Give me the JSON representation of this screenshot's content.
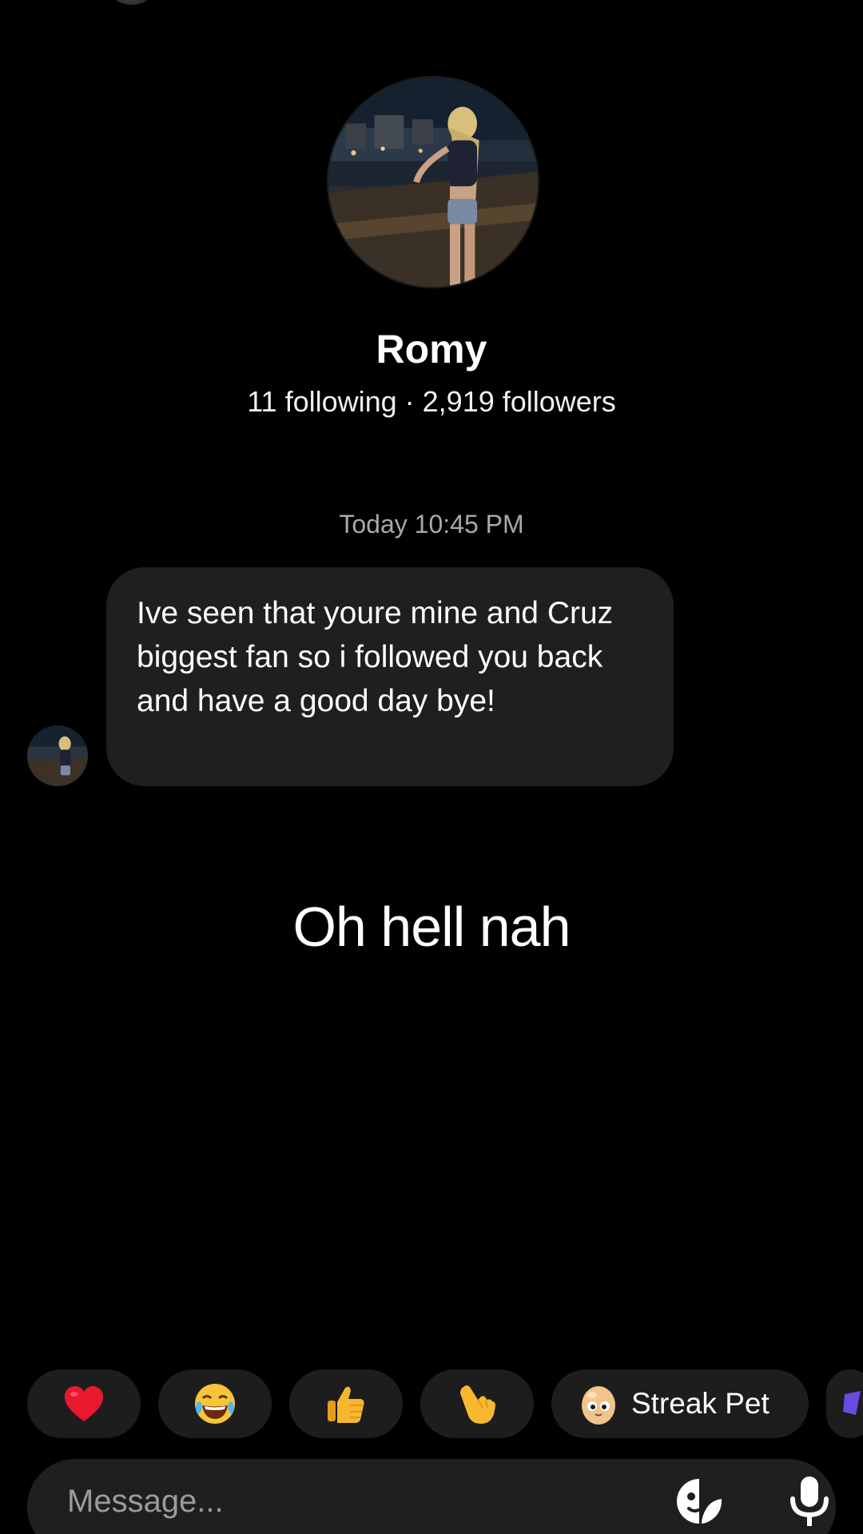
{
  "profile": {
    "name": "Romy",
    "stats": "11 following · 2,919 followers"
  },
  "thread": {
    "timestamp": "Today 10:45 PM",
    "messages": [
      {
        "text": "Ive seen that youre mine and Cruz biggest fan so i followed you back and have a good day bye!"
      }
    ]
  },
  "overlay": {
    "caption": "Oh hell nah"
  },
  "quick_replies": [
    {
      "icon": "red-heart-icon"
    },
    {
      "icon": "tears-of-joy-icon"
    },
    {
      "icon": "thumbs-up-icon"
    },
    {
      "icon": "pointing-hand-icon"
    },
    {
      "icon": "egg-pet-icon",
      "label": "Streak Pet"
    }
  ],
  "composer": {
    "placeholder": "Message..."
  },
  "colors": {
    "background": "#000000",
    "bubble": "#1f1f1f",
    "chip": "#1d1d1d",
    "muted_text": "#a9a9a9"
  }
}
